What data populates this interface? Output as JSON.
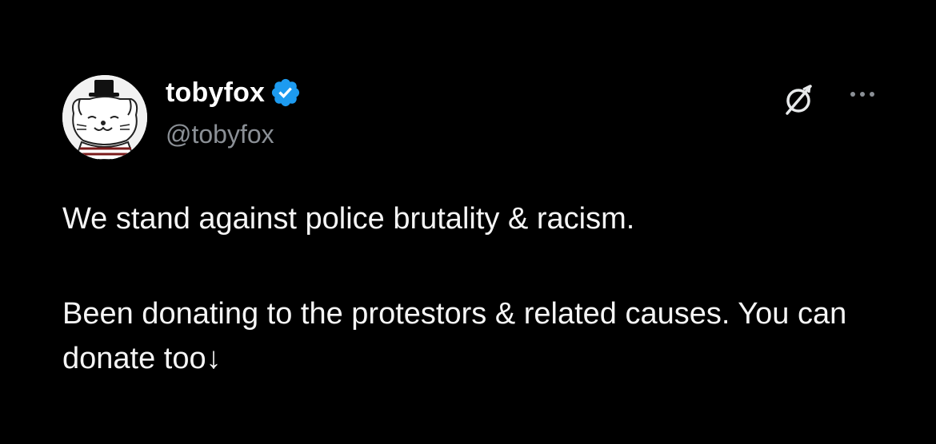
{
  "author": {
    "display_name": "tobyfox",
    "handle": "@tobyfox",
    "verified": true,
    "verified_badge_color": "#1d9bf0"
  },
  "icons": {
    "verified": "verified-badge-icon",
    "grok": "grok-icon",
    "more": "more-options-icon"
  },
  "tweet": {
    "line1": "We stand against police brutality & racism.",
    "line2": "Been donating to the protestors & related causes. You can donate too↓"
  },
  "colors": {
    "background": "#000000",
    "text": "#ffffff",
    "secondary_text": "#8b9096"
  }
}
